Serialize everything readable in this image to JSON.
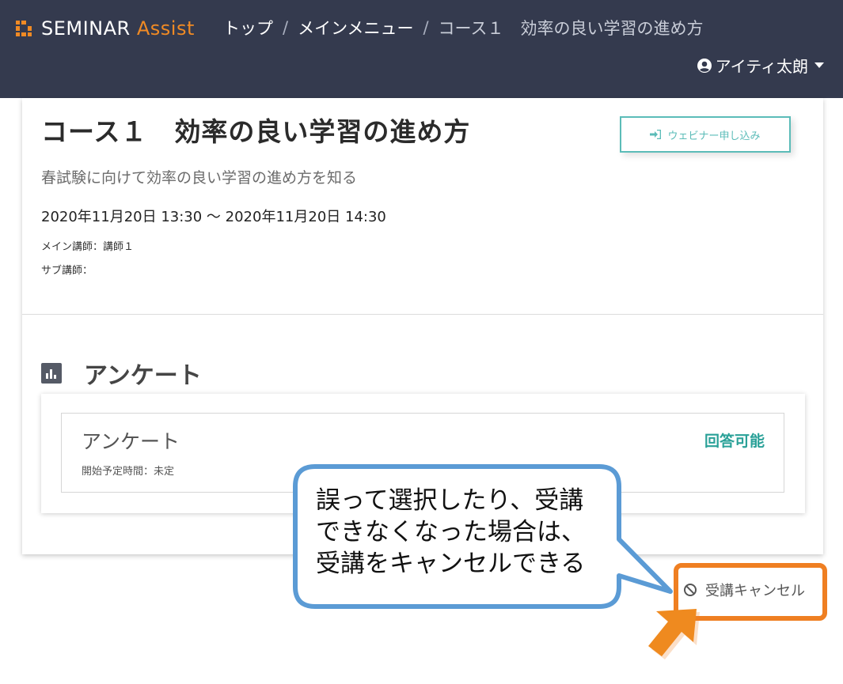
{
  "header": {
    "logo_main": "SEMINAR",
    "logo_accent": "Assist",
    "breadcrumb": [
      {
        "label": "トップ"
      },
      {
        "label": "メインメニュー"
      },
      {
        "label": "コース１　効率の良い学習の進め方"
      }
    ],
    "separator": "/",
    "user_name": "アイティ太朗"
  },
  "course": {
    "title": "コース１　効率の良い学習の進め方",
    "webinar_button": "ウェビナー申し込み",
    "description": "春試験に向けて効率の良い学習の進め方を知る",
    "datetime": "2020年11月20日 13:30 ～ 2020年11月20日 14:30",
    "main_lecturer": "メイン講師：講師１",
    "sub_lecturer": "サブ講師："
  },
  "survey_section": {
    "title": "アンケート",
    "item": {
      "name": "アンケート",
      "status": "回答可能",
      "start_time": "開始予定時間：未定"
    }
  },
  "cancel": {
    "label": "受講キャンセル"
  },
  "callout": {
    "text": "誤って選択したり、受講\nできなくなった場合は、\n受講をキャンセルできる"
  },
  "colors": {
    "header_bg": "#343a4e",
    "brand_orange": "#f08a24",
    "accent_teal": "#5bbcb8",
    "status_green": "#2aa198",
    "callout_border": "#5b9bd5",
    "highlight_orange": "#ef7f22"
  }
}
